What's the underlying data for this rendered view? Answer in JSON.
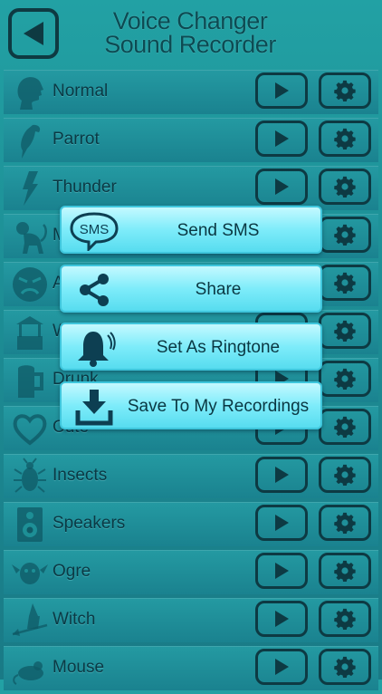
{
  "app": {
    "title_line1": "Voice Changer",
    "title_line2": "Sound Recorder"
  },
  "colors": {
    "accent": "#0d3a43",
    "menu": "#7eecfa",
    "background": "#1d8f96"
  },
  "rows": [
    {
      "label": "Normal",
      "icon": "human-head-icon"
    },
    {
      "label": "Parrot",
      "icon": "parrot-icon"
    },
    {
      "label": "Thunder",
      "icon": "thunder-icon"
    },
    {
      "label": "M",
      "icon": "monkey-icon"
    },
    {
      "label": "A",
      "icon": "angry-face-icon"
    },
    {
      "label": "W",
      "icon": "well-icon"
    },
    {
      "label": "Drunk",
      "icon": "beer-mug-icon"
    },
    {
      "label": "Cute",
      "icon": "heart-icon"
    },
    {
      "label": "Insects",
      "icon": "beetle-icon"
    },
    {
      "label": "Speakers",
      "icon": "speaker-icon"
    },
    {
      "label": "Ogre",
      "icon": "ogre-icon"
    },
    {
      "label": "Witch",
      "icon": "witch-icon"
    },
    {
      "label": "Mouse",
      "icon": "mouse-icon"
    }
  ],
  "menu": {
    "send_sms": {
      "label": "Send SMS",
      "icon_text": "SMS"
    },
    "share": {
      "label": "Share"
    },
    "ringtone": {
      "label": "Set As Ringtone"
    },
    "save": {
      "label": "Save To My Recordings"
    }
  }
}
